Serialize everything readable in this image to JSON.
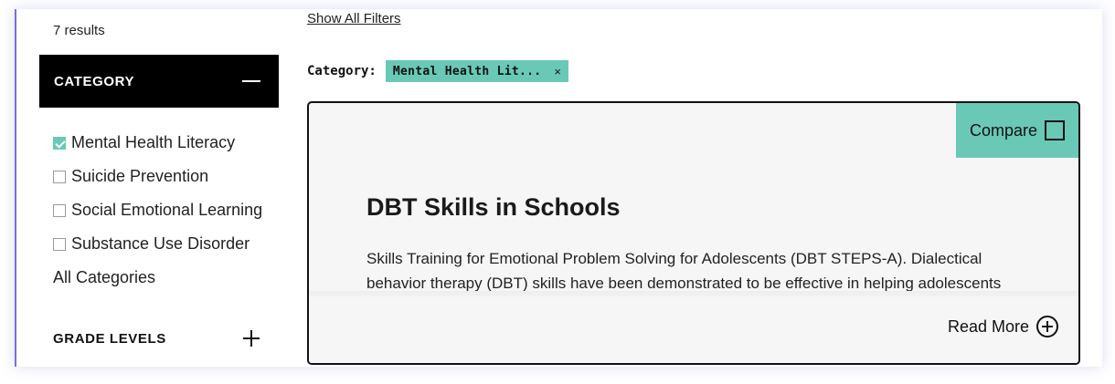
{
  "sidebar": {
    "results_count": "7 results",
    "category": {
      "title": "CATEGORY",
      "expanded": true,
      "items": [
        {
          "label": "Mental Health Literacy",
          "checked": true
        },
        {
          "label": "Suicide Prevention",
          "checked": false
        },
        {
          "label": "Social Emotional Learning",
          "checked": false
        },
        {
          "label": "Substance Use Disorder",
          "checked": false
        }
      ],
      "all_label": "All Categories"
    },
    "grade_levels": {
      "title": "GRADE LEVELS",
      "expanded": false
    }
  },
  "filters": {
    "show_all_label": "Show All Filters",
    "active_label": "Category:",
    "active_chip": "Mental Health Lit...",
    "chip_close": "×"
  },
  "card": {
    "compare_label": "Compare",
    "title": "DBT Skills in Schools",
    "description": "Skills Training for Emotional Problem Solving for Adolescents (DBT STEPS-A). Dialectical behavior therapy (DBT) skills have been demonstrated to be effective in helping adolescents",
    "read_more_label": "Read More"
  },
  "colors": {
    "accent": "#69c9b6",
    "header_bg": "#000000",
    "card_bg": "#f6f6f7"
  }
}
